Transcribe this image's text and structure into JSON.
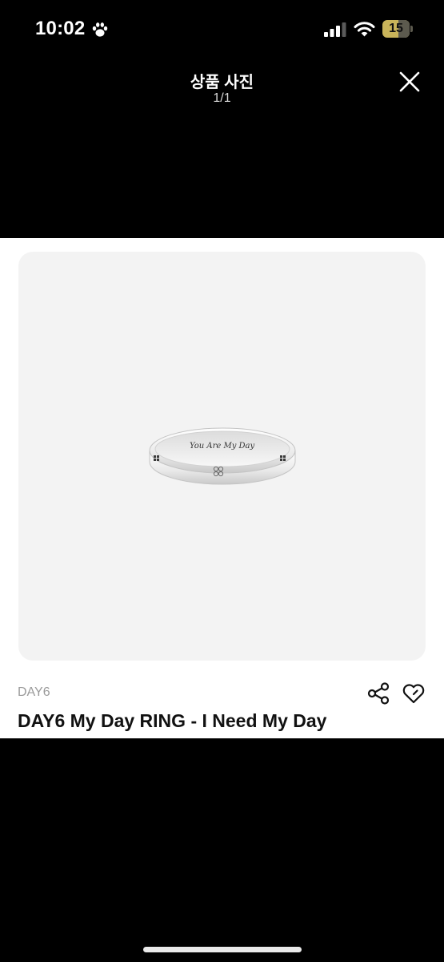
{
  "status_bar": {
    "time": "10:02",
    "battery": "15"
  },
  "header": {
    "title": "상품 사진",
    "counter": "1/1"
  },
  "product": {
    "brand": "DAY6",
    "title": "DAY6 My Day RING - I Need My Day",
    "engraving": "You Are My Day"
  },
  "icons": {
    "status": [
      "paw-icon",
      "signal-icon",
      "wifi-icon",
      "battery-icon"
    ],
    "actions": [
      "close-icon",
      "share-icon",
      "heart-icon"
    ]
  }
}
